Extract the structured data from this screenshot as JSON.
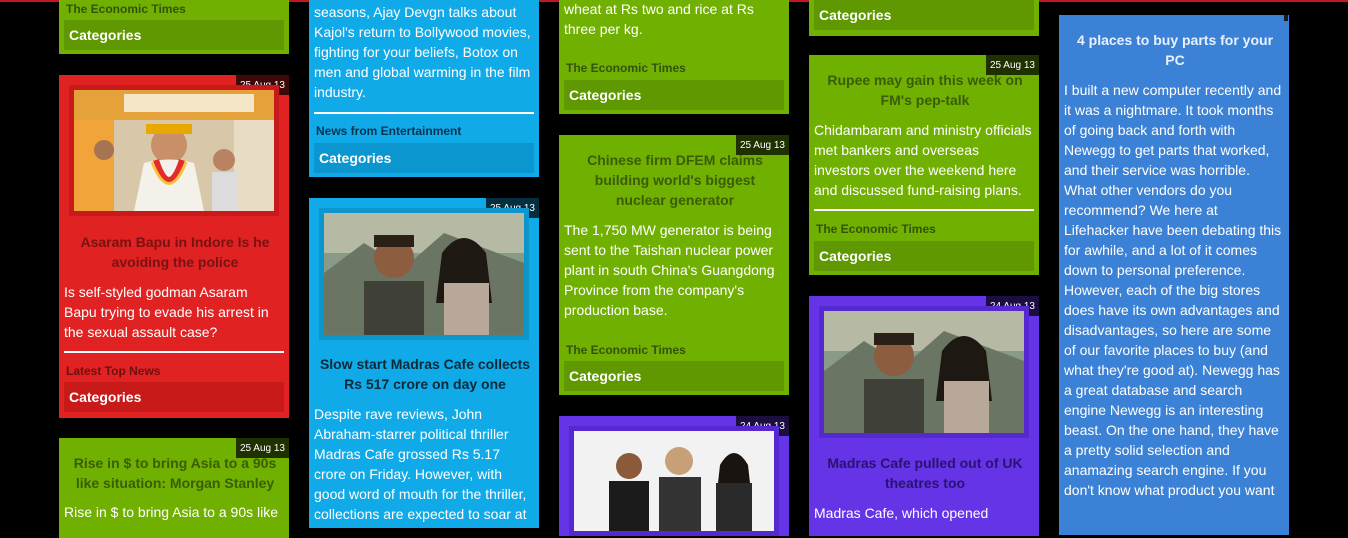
{
  "colors": {
    "red": "#e02222",
    "green": "#70b000",
    "blue": "#10aae8",
    "purple": "#6434e6",
    "pc_blue": "#3b82d6"
  },
  "col1": {
    "top": {
      "source": "The Economic Times",
      "categories": "Categories"
    },
    "asaram": {
      "date": "25 Aug 13",
      "title": "Asaram Bapu in Indore Is he avoiding the police",
      "desc": "Is self-styled godman Asaram Bapu trying to evade his arrest in the sexual assault case?",
      "source": "Latest Top News",
      "categories": "Categories"
    },
    "rise": {
      "date": "25 Aug 13",
      "title": "Rise in $ to bring Asia to a 90s like situation: Morgan Stanley",
      "desc": "Rise in $ to bring Asia to a 90s like"
    }
  },
  "col2": {
    "top": {
      "desc": "seasons, Ajay Devgn talks about Kajol's return to Bollywood movies, fighting for your beliefs, Botox on men and global warming in the film industry.",
      "source": "News from Entertainment",
      "categories": "Categories"
    },
    "madras": {
      "date": "25 Aug 13",
      "title": "Slow start Madras Cafe collects Rs 517 crore on day one",
      "desc": "Despite rave reviews, John Abraham-starrer political thriller Madras Cafe grossed Rs 5.17 crore on Friday. However, with good word of mouth for the thriller, collections are expected to soar at"
    }
  },
  "col3": {
    "top": {
      "desc": "wheat at Rs two and rice at Rs three per kg.",
      "source": "The Economic Times",
      "categories": "Categories"
    },
    "dfem": {
      "date": "25 Aug 13",
      "title": "Chinese firm DFEM claims building world's biggest nuclear generator",
      "desc": "The 1,750 MW generator is being sent to the Taishan nuclear power plant in south China's Guangdong Province from the company's production base.",
      "source": "The Economic Times",
      "categories": "Categories"
    },
    "irrfan": {
      "date": "24 Aug 13"
    }
  },
  "col4": {
    "top": {
      "categories": "Categories"
    },
    "rupee": {
      "date": "25 Aug 13",
      "title": "Rupee may gain this week on FM's pep-talk",
      "desc": "Chidambaram and ministry officials met bankers and overseas investors over the weekend here and discussed fund-raising plans.",
      "source": "The Economic Times",
      "categories": "Categories"
    },
    "madras_uk": {
      "date": "24 Aug 13",
      "title": "Madras Cafe pulled out of UK theatres too",
      "desc": "Madras Cafe, which opened"
    }
  },
  "col5": {
    "pc": {
      "title": "4 places to buy parts for your PC",
      "desc": "I built a new computer recently and it was a nightmare. It took months of going back and forth with Newegg to get parts that worked, and their service was horrible. What other vendors do you recommend? We here at Lifehacker have been debating this for awhile, and a lot of it comes down to personal preference. However, each of the big stores does have its own advantages and disadvantages, so here are some of our favorite places to buy (and what they're good at). Newegg has a great database and search engine Newegg is an interesting beast. On the one hand, they have a pretty solid selection and anamazing search engine. If you don't know what product you want"
    }
  }
}
